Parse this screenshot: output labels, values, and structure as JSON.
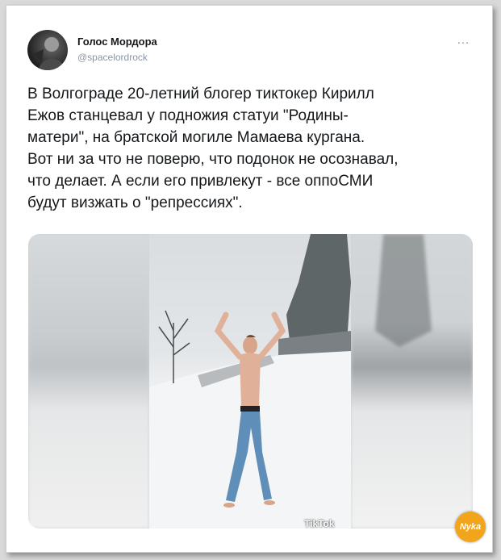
{
  "tweet": {
    "author_name": "Голос Мордора",
    "author_handle": "@spacelordrock",
    "more_icon": "…",
    "text": "В Волгограде 20-летний блогер тиктокер Кирилл\nЕжов станцевал у подножия статуи \"Родины-\nматери\", на братской могиле Мамаева кургана.\nВот ни за что не поверю, что подонок не осознавал,\nчто делает. А если его привлекут - все оппоСМИ\nбудут визжать о \"репрессиях\"."
  },
  "media": {
    "watermark": "TikTok"
  },
  "site_logo": {
    "text": "Nyka"
  }
}
